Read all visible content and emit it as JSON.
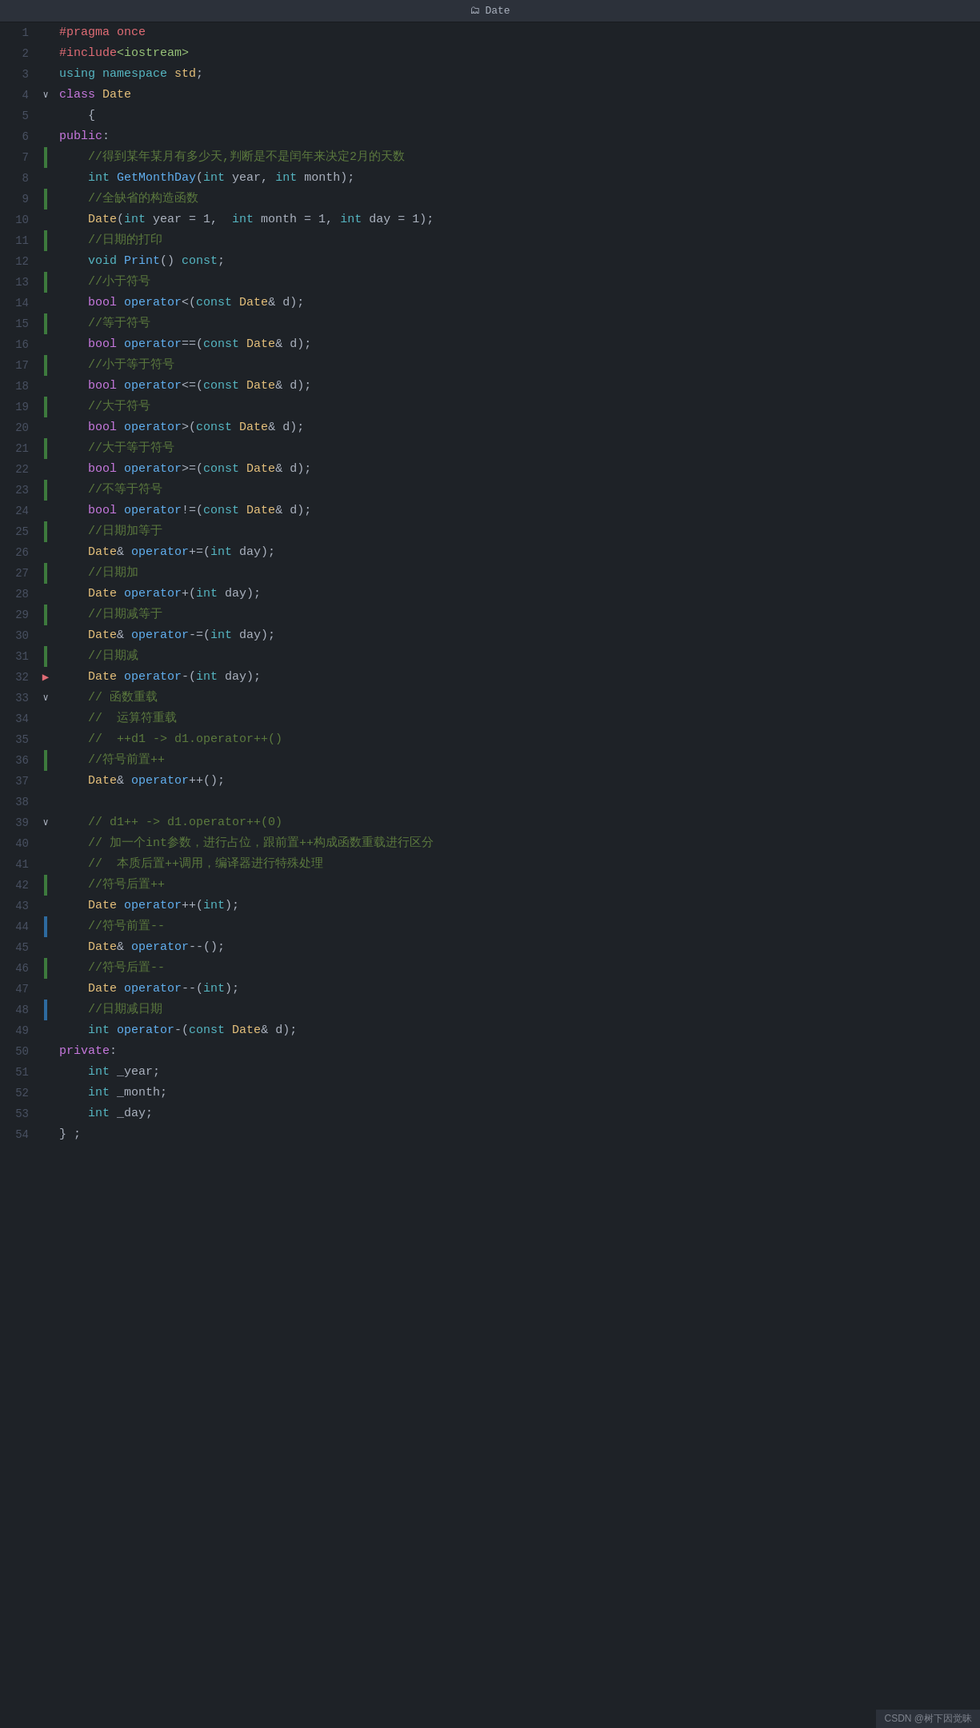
{
  "title": "Date",
  "footer": "CSDN @树下因觉昧",
  "lines": [
    {
      "num": 1,
      "gutter": "",
      "content": [
        {
          "t": "prepro",
          "v": "#pragma once"
        }
      ]
    },
    {
      "num": 2,
      "gutter": "",
      "content": [
        {
          "t": "prepro",
          "v": "#include"
        },
        {
          "t": "string",
          "v": "<iostream>"
        }
      ]
    },
    {
      "num": 3,
      "gutter": "",
      "content": [
        {
          "t": "kw",
          "v": "using"
        },
        {
          "t": "normal",
          "v": " "
        },
        {
          "t": "kw",
          "v": "namespace"
        },
        {
          "t": "normal",
          "v": " "
        },
        {
          "t": "ns",
          "v": "std"
        },
        {
          "t": "normal",
          "v": ";"
        }
      ]
    },
    {
      "num": 4,
      "gutter": "chevron-down",
      "content": [
        {
          "t": "kw2",
          "v": "class"
        },
        {
          "t": "normal",
          "v": " "
        },
        {
          "t": "classname",
          "v": "Date"
        }
      ]
    },
    {
      "num": 5,
      "gutter": "",
      "content": [
        {
          "t": "normal",
          "v": "    {"
        }
      ]
    },
    {
      "num": 6,
      "gutter": "",
      "content": [
        {
          "t": "kw2",
          "v": "public"
        },
        {
          "t": "normal",
          "v": ":"
        }
      ]
    },
    {
      "num": 7,
      "gutter": "green",
      "content": [
        {
          "t": "normal",
          "v": "    "
        },
        {
          "t": "comment",
          "v": "//得到某年某月有多少天,判断是不是闰年来决定2月的天数"
        }
      ]
    },
    {
      "num": 8,
      "gutter": "",
      "content": [
        {
          "t": "normal",
          "v": "    "
        },
        {
          "t": "kw",
          "v": "int"
        },
        {
          "t": "normal",
          "v": " "
        },
        {
          "t": "fn",
          "v": "GetMonthDay"
        },
        {
          "t": "normal",
          "v": "("
        },
        {
          "t": "kw",
          "v": "int"
        },
        {
          "t": "normal",
          "v": " year, "
        },
        {
          "t": "kw",
          "v": "int"
        },
        {
          "t": "normal",
          "v": " month);"
        }
      ]
    },
    {
      "num": 9,
      "gutter": "green",
      "content": [
        {
          "t": "normal",
          "v": "    "
        },
        {
          "t": "comment",
          "v": "//全缺省的构造函数"
        }
      ]
    },
    {
      "num": 10,
      "gutter": "",
      "content": [
        {
          "t": "normal",
          "v": "    "
        },
        {
          "t": "classname",
          "v": "Date"
        },
        {
          "t": "normal",
          "v": "("
        },
        {
          "t": "kw",
          "v": "int"
        },
        {
          "t": "normal",
          "v": " year = 1,  "
        },
        {
          "t": "kw",
          "v": "int"
        },
        {
          "t": "normal",
          "v": " month = 1, "
        },
        {
          "t": "kw",
          "v": "int"
        },
        {
          "t": "normal",
          "v": " day = 1);"
        }
      ]
    },
    {
      "num": 11,
      "gutter": "green",
      "content": [
        {
          "t": "normal",
          "v": "    "
        },
        {
          "t": "comment",
          "v": "//日期的打印"
        }
      ]
    },
    {
      "num": 12,
      "gutter": "",
      "content": [
        {
          "t": "normal",
          "v": "    "
        },
        {
          "t": "kw",
          "v": "void"
        },
        {
          "t": "normal",
          "v": " "
        },
        {
          "t": "fn",
          "v": "Print"
        },
        {
          "t": "normal",
          "v": "() "
        },
        {
          "t": "kw",
          "v": "const"
        },
        {
          "t": "normal",
          "v": ";"
        }
      ]
    },
    {
      "num": 13,
      "gutter": "green",
      "content": [
        {
          "t": "normal",
          "v": "    "
        },
        {
          "t": "comment",
          "v": "//小于符号"
        }
      ]
    },
    {
      "num": 14,
      "gutter": "",
      "content": [
        {
          "t": "normal",
          "v": "    "
        },
        {
          "t": "kw2",
          "v": "bool"
        },
        {
          "t": "normal",
          "v": " "
        },
        {
          "t": "fn",
          "v": "operator"
        },
        {
          "t": "normal",
          "v": "<("
        },
        {
          "t": "kw",
          "v": "const"
        },
        {
          "t": "normal",
          "v": " "
        },
        {
          "t": "classname",
          "v": "Date"
        },
        {
          "t": "normal",
          "v": "& d);"
        }
      ]
    },
    {
      "num": 15,
      "gutter": "green",
      "content": [
        {
          "t": "normal",
          "v": "    "
        },
        {
          "t": "comment",
          "v": "//等于符号"
        }
      ]
    },
    {
      "num": 16,
      "gutter": "",
      "content": [
        {
          "t": "normal",
          "v": "    "
        },
        {
          "t": "kw2",
          "v": "bool"
        },
        {
          "t": "normal",
          "v": " "
        },
        {
          "t": "fn",
          "v": "operator"
        },
        {
          "t": "normal",
          "v": "==("
        },
        {
          "t": "kw",
          "v": "const"
        },
        {
          "t": "normal",
          "v": " "
        },
        {
          "t": "classname",
          "v": "Date"
        },
        {
          "t": "normal",
          "v": "& d);"
        }
      ]
    },
    {
      "num": 17,
      "gutter": "green",
      "content": [
        {
          "t": "normal",
          "v": "    "
        },
        {
          "t": "comment",
          "v": "//小于等于符号"
        }
      ]
    },
    {
      "num": 18,
      "gutter": "",
      "content": [
        {
          "t": "normal",
          "v": "    "
        },
        {
          "t": "kw2",
          "v": "bool"
        },
        {
          "t": "normal",
          "v": " "
        },
        {
          "t": "fn",
          "v": "operator"
        },
        {
          "t": "normal",
          "v": "<=("
        },
        {
          "t": "kw",
          "v": "const"
        },
        {
          "t": "normal",
          "v": " "
        },
        {
          "t": "classname",
          "v": "Date"
        },
        {
          "t": "normal",
          "v": "& d);"
        }
      ]
    },
    {
      "num": 19,
      "gutter": "green",
      "content": [
        {
          "t": "normal",
          "v": "    "
        },
        {
          "t": "comment",
          "v": "//大于符号"
        }
      ]
    },
    {
      "num": 20,
      "gutter": "",
      "content": [
        {
          "t": "normal",
          "v": "    "
        },
        {
          "t": "kw2",
          "v": "bool"
        },
        {
          "t": "normal",
          "v": " "
        },
        {
          "t": "fn",
          "v": "operator"
        },
        {
          "t": "normal",
          "v": ">("
        },
        {
          "t": "kw",
          "v": "const"
        },
        {
          "t": "normal",
          "v": " "
        },
        {
          "t": "classname",
          "v": "Date"
        },
        {
          "t": "normal",
          "v": "& d);"
        }
      ]
    },
    {
      "num": 21,
      "gutter": "green",
      "content": [
        {
          "t": "normal",
          "v": "    "
        },
        {
          "t": "comment",
          "v": "//大于等于符号"
        }
      ]
    },
    {
      "num": 22,
      "gutter": "",
      "content": [
        {
          "t": "normal",
          "v": "    "
        },
        {
          "t": "kw2",
          "v": "bool"
        },
        {
          "t": "normal",
          "v": " "
        },
        {
          "t": "fn",
          "v": "operator"
        },
        {
          "t": "normal",
          "v": ">=("
        },
        {
          "t": "kw",
          "v": "const"
        },
        {
          "t": "normal",
          "v": " "
        },
        {
          "t": "classname",
          "v": "Date"
        },
        {
          "t": "normal",
          "v": "& d);"
        }
      ]
    },
    {
      "num": 23,
      "gutter": "green",
      "content": [
        {
          "t": "normal",
          "v": "    "
        },
        {
          "t": "comment",
          "v": "//不等于符号"
        }
      ]
    },
    {
      "num": 24,
      "gutter": "",
      "content": [
        {
          "t": "normal",
          "v": "    "
        },
        {
          "t": "kw2",
          "v": "bool"
        },
        {
          "t": "normal",
          "v": " "
        },
        {
          "t": "fn",
          "v": "operator"
        },
        {
          "t": "normal",
          "v": "!=("
        },
        {
          "t": "kw",
          "v": "const"
        },
        {
          "t": "normal",
          "v": " "
        },
        {
          "t": "classname",
          "v": "Date"
        },
        {
          "t": "normal",
          "v": "& d);"
        }
      ]
    },
    {
      "num": 25,
      "gutter": "green",
      "content": [
        {
          "t": "normal",
          "v": "    "
        },
        {
          "t": "comment",
          "v": "//日期加等于"
        }
      ]
    },
    {
      "num": 26,
      "gutter": "",
      "content": [
        {
          "t": "normal",
          "v": "    "
        },
        {
          "t": "classname",
          "v": "Date"
        },
        {
          "t": "normal",
          "v": "& "
        },
        {
          "t": "fn",
          "v": "operator"
        },
        {
          "t": "normal",
          "v": "+=("
        },
        {
          "t": "kw",
          "v": "int"
        },
        {
          "t": "normal",
          "v": " day);"
        }
      ]
    },
    {
      "num": 27,
      "gutter": "green",
      "content": [
        {
          "t": "normal",
          "v": "    "
        },
        {
          "t": "comment",
          "v": "//日期加"
        }
      ]
    },
    {
      "num": 28,
      "gutter": "",
      "content": [
        {
          "t": "normal",
          "v": "    "
        },
        {
          "t": "classname",
          "v": "Date"
        },
        {
          "t": "normal",
          "v": " "
        },
        {
          "t": "fn",
          "v": "operator"
        },
        {
          "t": "normal",
          "v": "+("
        },
        {
          "t": "kw",
          "v": "int"
        },
        {
          "t": "normal",
          "v": " day);"
        }
      ]
    },
    {
      "num": 29,
      "gutter": "green",
      "content": [
        {
          "t": "normal",
          "v": "    "
        },
        {
          "t": "comment",
          "v": "//日期减等于"
        }
      ]
    },
    {
      "num": 30,
      "gutter": "",
      "content": [
        {
          "t": "normal",
          "v": "    "
        },
        {
          "t": "classname",
          "v": "Date"
        },
        {
          "t": "normal",
          "v": "& "
        },
        {
          "t": "fn",
          "v": "operator"
        },
        {
          "t": "normal",
          "v": "-=("
        },
        {
          "t": "kw",
          "v": "int"
        },
        {
          "t": "normal",
          "v": " day);"
        }
      ]
    },
    {
      "num": 31,
      "gutter": "green",
      "content": [
        {
          "t": "normal",
          "v": "    "
        },
        {
          "t": "comment",
          "v": "//日期减"
        }
      ]
    },
    {
      "num": 32,
      "gutter": "arrow",
      "content": [
        {
          "t": "normal",
          "v": "    "
        },
        {
          "t": "classname",
          "v": "Date"
        },
        {
          "t": "normal",
          "v": " "
        },
        {
          "t": "fn",
          "v": "operator"
        },
        {
          "t": "normal",
          "v": "-("
        },
        {
          "t": "kw",
          "v": "int"
        },
        {
          "t": "normal",
          "v": " day);"
        }
      ]
    },
    {
      "num": 33,
      "gutter": "chevron-down",
      "content": [
        {
          "t": "normal",
          "v": "    "
        },
        {
          "t": "comment",
          "v": "// 函数重载"
        }
      ]
    },
    {
      "num": 34,
      "gutter": "",
      "content": [
        {
          "t": "normal",
          "v": "    "
        },
        {
          "t": "comment",
          "v": "//  运算符重载"
        }
      ]
    },
    {
      "num": 35,
      "gutter": "",
      "content": [
        {
          "t": "normal",
          "v": "    "
        },
        {
          "t": "comment",
          "v": "//  ++d1 -> d1.operator++()"
        }
      ]
    },
    {
      "num": 36,
      "gutter": "green",
      "content": [
        {
          "t": "normal",
          "v": "    "
        },
        {
          "t": "comment",
          "v": "//符号前置++"
        }
      ]
    },
    {
      "num": 37,
      "gutter": "",
      "content": [
        {
          "t": "normal",
          "v": "    "
        },
        {
          "t": "classname",
          "v": "Date"
        },
        {
          "t": "normal",
          "v": "& "
        },
        {
          "t": "fn",
          "v": "operator"
        },
        {
          "t": "normal",
          "v": "++();"
        }
      ]
    },
    {
      "num": 38,
      "gutter": "",
      "content": [
        {
          "t": "normal",
          "v": ""
        }
      ]
    },
    {
      "num": 39,
      "gutter": "chevron-down",
      "content": [
        {
          "t": "normal",
          "v": "    "
        },
        {
          "t": "comment",
          "v": "// d1++ -> d1.operator++(0)"
        }
      ]
    },
    {
      "num": 40,
      "gutter": "",
      "content": [
        {
          "t": "normal",
          "v": "    "
        },
        {
          "t": "comment",
          "v": "// 加一个int参数，进行占位，跟前置++构成函数重载进行区分"
        }
      ]
    },
    {
      "num": 41,
      "gutter": "",
      "content": [
        {
          "t": "normal",
          "v": "    "
        },
        {
          "t": "comment",
          "v": "//  本质后置++调用，编译器进行特殊处理"
        }
      ]
    },
    {
      "num": 42,
      "gutter": "green",
      "content": [
        {
          "t": "normal",
          "v": "    "
        },
        {
          "t": "comment",
          "v": "//符号后置++"
        }
      ]
    },
    {
      "num": 43,
      "gutter": "",
      "content": [
        {
          "t": "normal",
          "v": "    "
        },
        {
          "t": "classname",
          "v": "Date"
        },
        {
          "t": "normal",
          "v": " "
        },
        {
          "t": "fn",
          "v": "operator"
        },
        {
          "t": "normal",
          "v": "++("
        },
        {
          "t": "kw",
          "v": "int"
        },
        {
          "t": "normal",
          "v": ");"
        }
      ]
    },
    {
      "num": 44,
      "gutter": "blue",
      "content": [
        {
          "t": "normal",
          "v": "    "
        },
        {
          "t": "comment",
          "v": "//符号前置--"
        }
      ]
    },
    {
      "num": 45,
      "gutter": "",
      "content": [
        {
          "t": "normal",
          "v": "    "
        },
        {
          "t": "classname",
          "v": "Date"
        },
        {
          "t": "normal",
          "v": "& "
        },
        {
          "t": "fn",
          "v": "operator"
        },
        {
          "t": "normal",
          "v": "--();"
        }
      ]
    },
    {
      "num": 46,
      "gutter": "green",
      "content": [
        {
          "t": "normal",
          "v": "    "
        },
        {
          "t": "comment",
          "v": "//符号后置--"
        }
      ]
    },
    {
      "num": 47,
      "gutter": "",
      "content": [
        {
          "t": "normal",
          "v": "    "
        },
        {
          "t": "classname",
          "v": "Date"
        },
        {
          "t": "normal",
          "v": " "
        },
        {
          "t": "fn",
          "v": "operator"
        },
        {
          "t": "normal",
          "v": "--("
        },
        {
          "t": "kw",
          "v": "int"
        },
        {
          "t": "normal",
          "v": ");"
        }
      ]
    },
    {
      "num": 48,
      "gutter": "blue",
      "content": [
        {
          "t": "normal",
          "v": "    "
        },
        {
          "t": "comment",
          "v": "//日期减日期"
        }
      ]
    },
    {
      "num": 49,
      "gutter": "",
      "content": [
        {
          "t": "normal",
          "v": "    "
        },
        {
          "t": "kw",
          "v": "int"
        },
        {
          "t": "normal",
          "v": " "
        },
        {
          "t": "fn",
          "v": "operator"
        },
        {
          "t": "normal",
          "v": "-("
        },
        {
          "t": "kw",
          "v": "const"
        },
        {
          "t": "normal",
          "v": " "
        },
        {
          "t": "classname",
          "v": "Date"
        },
        {
          "t": "normal",
          "v": "& d);"
        }
      ]
    },
    {
      "num": 50,
      "gutter": "",
      "content": [
        {
          "t": "kw2",
          "v": "private"
        },
        {
          "t": "normal",
          "v": ":"
        }
      ]
    },
    {
      "num": 51,
      "gutter": "",
      "content": [
        {
          "t": "normal",
          "v": "    "
        },
        {
          "t": "kw",
          "v": "int"
        },
        {
          "t": "normal",
          "v": " "
        },
        {
          "t": "normal",
          "v": "_year"
        },
        {
          "t": "normal",
          "v": ";"
        }
      ]
    },
    {
      "num": 52,
      "gutter": "",
      "content": [
        {
          "t": "normal",
          "v": "    "
        },
        {
          "t": "kw",
          "v": "int"
        },
        {
          "t": "normal",
          "v": " "
        },
        {
          "t": "normal",
          "v": "_month"
        },
        {
          "t": "normal",
          "v": ";"
        }
      ]
    },
    {
      "num": 53,
      "gutter": "",
      "content": [
        {
          "t": "normal",
          "v": "    "
        },
        {
          "t": "kw",
          "v": "int"
        },
        {
          "t": "normal",
          "v": " "
        },
        {
          "t": "normal",
          "v": "_day"
        },
        {
          "t": "normal",
          "v": ";"
        }
      ]
    },
    {
      "num": 54,
      "gutter": "",
      "content": [
        {
          "t": "normal",
          "v": "} ;"
        }
      ]
    }
  ]
}
